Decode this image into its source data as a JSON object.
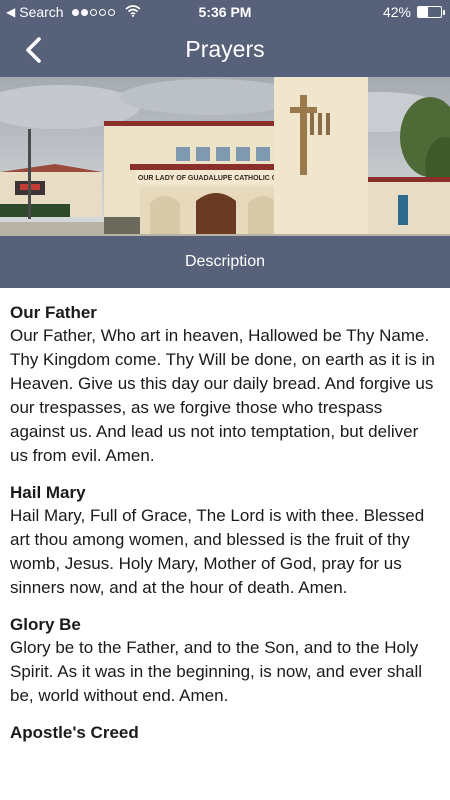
{
  "status_bar": {
    "back_app": "Search",
    "time": "5:36 PM",
    "battery_percent": "42%",
    "battery_level": 0.42,
    "signal_dots_filled": 2,
    "signal_dots_total": 5
  },
  "nav": {
    "title": "Prayers",
    "back_icon": "chevron-left-icon"
  },
  "photo": {
    "church_sign": "OUR LADY OF GUADALUPE CATHOLIC CHURCH"
  },
  "description_tab": {
    "label": "Description"
  },
  "prayers": [
    {
      "title": "Our Father",
      "text": "Our Father, Who art in heaven, Hallowed be Thy Name. Thy Kingdom come. Thy Will be done, on earth as it is in Heaven. Give us this day our daily bread. And forgive us our trespasses, as we forgive those who trespass against us. And lead us not into temptation, but deliver us from evil. Amen."
    },
    {
      "title": "Hail Mary",
      "text": "Hail Mary, Full of Grace, The Lord is with thee. Blessed art thou among women, and blessed is the fruit of thy womb, Jesus. Holy Mary, Mother of God, pray for us sinners now, and at the hour of death. Amen."
    },
    {
      "title": "Glory Be",
      "text": "Glory be to the Father, and to the Son, and to the Holy Spirit. As it was in the beginning, is now, and ever shall be, world without end. Amen."
    },
    {
      "title": "Apostle's Creed",
      "text": ""
    }
  ],
  "colors": {
    "header_bg": "#576179",
    "text": "#1a1a1a"
  }
}
